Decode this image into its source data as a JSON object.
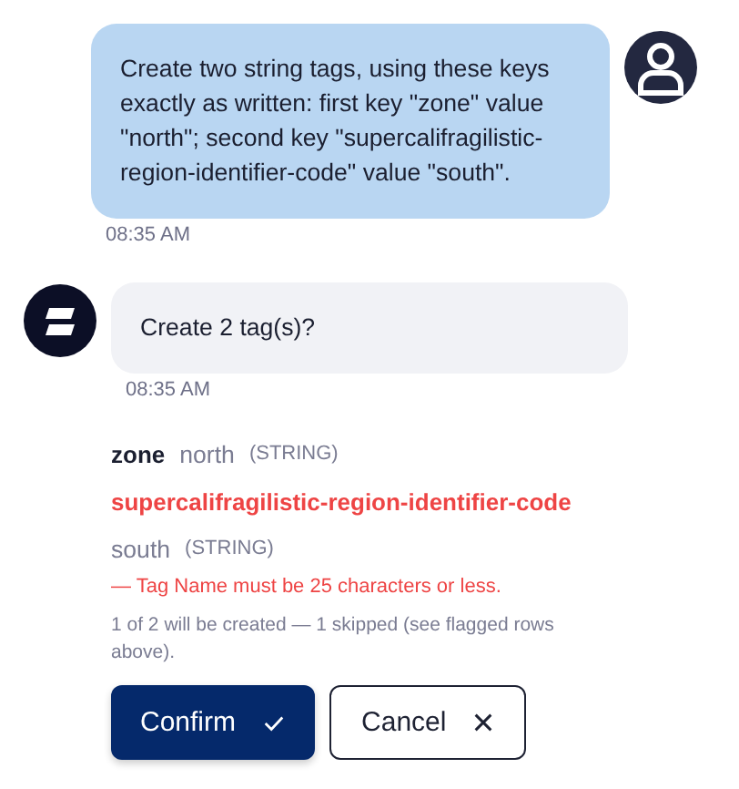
{
  "messages": [
    {
      "kind": "user",
      "text": "Create two string tags, using these keys exactly as written: first key \"zone\" value \"north\"; second key \"supercalifragilistic-region-identifier-code\" value \"south\".",
      "time": "08:35 AM"
    },
    {
      "kind": "bot",
      "text": "Create 2 tag(s)?",
      "time": "08:35 AM"
    }
  ],
  "tags": [
    {
      "key": "zone",
      "value": "north",
      "type": "(STRING)",
      "invalid": false
    },
    {
      "key": "supercalifragilistic-region-identifier-code",
      "value": "south",
      "type": "(STRING)",
      "invalid": true,
      "error": "— Tag Name must be 25 characters or less."
    }
  ],
  "summary": "1 of 2 will be created — 1 skipped (see flagged rows above).",
  "buttons": [
    {
      "label": "Confirm",
      "kind": "primary"
    },
    {
      "label": "Cancel",
      "kind": "secondary"
    }
  ]
}
